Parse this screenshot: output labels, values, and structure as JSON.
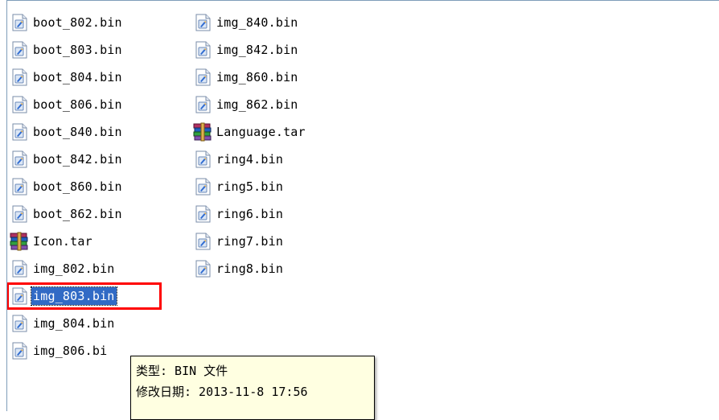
{
  "files_col1": [
    {
      "name": "boot_802.bin",
      "icon": "file-icon",
      "selected": false
    },
    {
      "name": "boot_803.bin",
      "icon": "file-icon",
      "selected": false
    },
    {
      "name": "boot_804.bin",
      "icon": "file-icon",
      "selected": false
    },
    {
      "name": "boot_806.bin",
      "icon": "file-icon",
      "selected": false
    },
    {
      "name": "boot_840.bin",
      "icon": "file-icon",
      "selected": false
    },
    {
      "name": "boot_842.bin",
      "icon": "file-icon",
      "selected": false
    },
    {
      "name": "boot_860.bin",
      "icon": "file-icon",
      "selected": false
    },
    {
      "name": "boot_862.bin",
      "icon": "file-icon",
      "selected": false
    },
    {
      "name": "Icon.tar",
      "icon": "archive-icon",
      "selected": false
    },
    {
      "name": "img_802.bin",
      "icon": "file-icon",
      "selected": false
    },
    {
      "name": "img_803.bin",
      "icon": "file-icon",
      "selected": true
    },
    {
      "name": "img_804.bin",
      "icon": "file-icon",
      "selected": false
    },
    {
      "name": "img_806.bi",
      "icon": "file-icon",
      "selected": false
    }
  ],
  "files_col2": [
    {
      "name": "img_840.bin",
      "icon": "file-icon",
      "selected": false
    },
    {
      "name": "img_842.bin",
      "icon": "file-icon",
      "selected": false
    },
    {
      "name": "img_860.bin",
      "icon": "file-icon",
      "selected": false
    },
    {
      "name": "img_862.bin",
      "icon": "file-icon",
      "selected": false
    },
    {
      "name": "Language.tar",
      "icon": "archive-icon",
      "selected": false
    },
    {
      "name": "ring4.bin",
      "icon": "file-icon",
      "selected": false
    },
    {
      "name": "ring5.bin",
      "icon": "file-icon",
      "selected": false
    },
    {
      "name": "ring6.bin",
      "icon": "file-icon",
      "selected": false
    },
    {
      "name": "ring7.bin",
      "icon": "file-icon",
      "selected": false
    },
    {
      "name": "ring8.bin",
      "icon": "file-icon",
      "selected": false
    }
  ],
  "tooltip": {
    "type_line": "类型: BIN 文件",
    "modified_line": "修改日期: 2013-11-8 17:56"
  },
  "colors": {
    "selection": "#316ac5",
    "highlight_border": "#ff0000",
    "tooltip_bg": "#ffffe1"
  }
}
